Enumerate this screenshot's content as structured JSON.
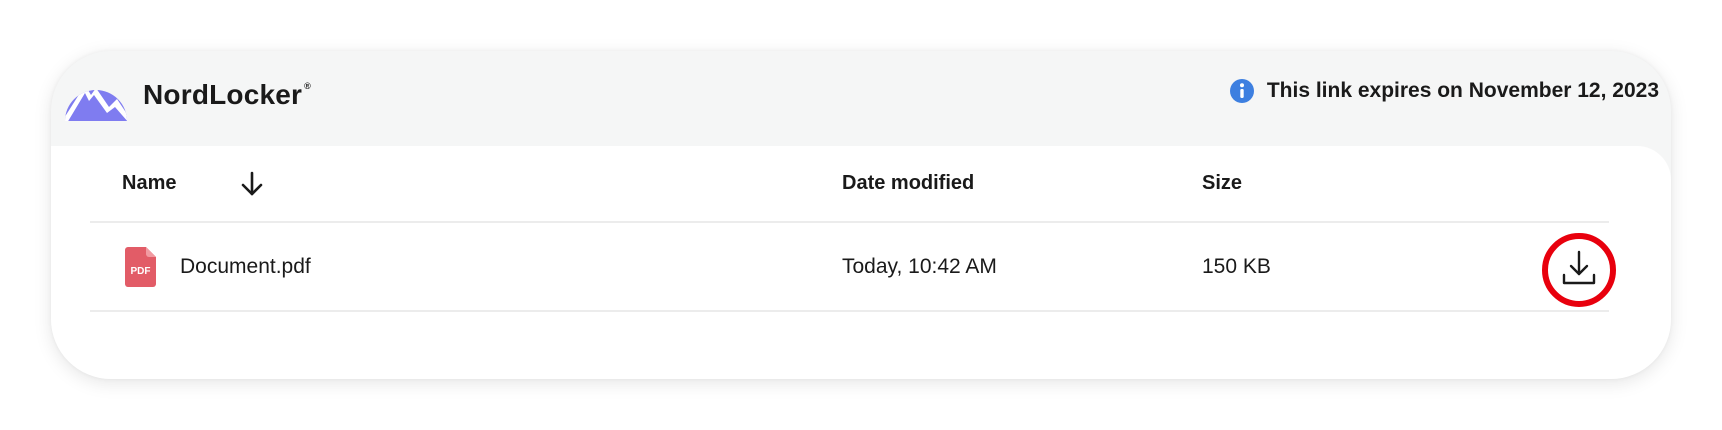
{
  "brand": {
    "name": "NordLocker",
    "reg_mark": "®",
    "color": "#7f7cf0"
  },
  "notice": {
    "icon": "info-icon",
    "text": "This link expires on November 12, 2023",
    "icon_color": "#3d7fe0"
  },
  "table": {
    "columns": {
      "name": "Name",
      "date": "Date modified",
      "size": "Size"
    },
    "sort_icon": "arrow-down-icon",
    "rows": [
      {
        "icon": "pdf-file-icon",
        "icon_label": "PDF",
        "name": "Document.pdf",
        "date": "Today, 10:42 AM",
        "size": "150 KB",
        "action_icon": "download-icon"
      }
    ]
  },
  "highlight_color": "#e8000d"
}
